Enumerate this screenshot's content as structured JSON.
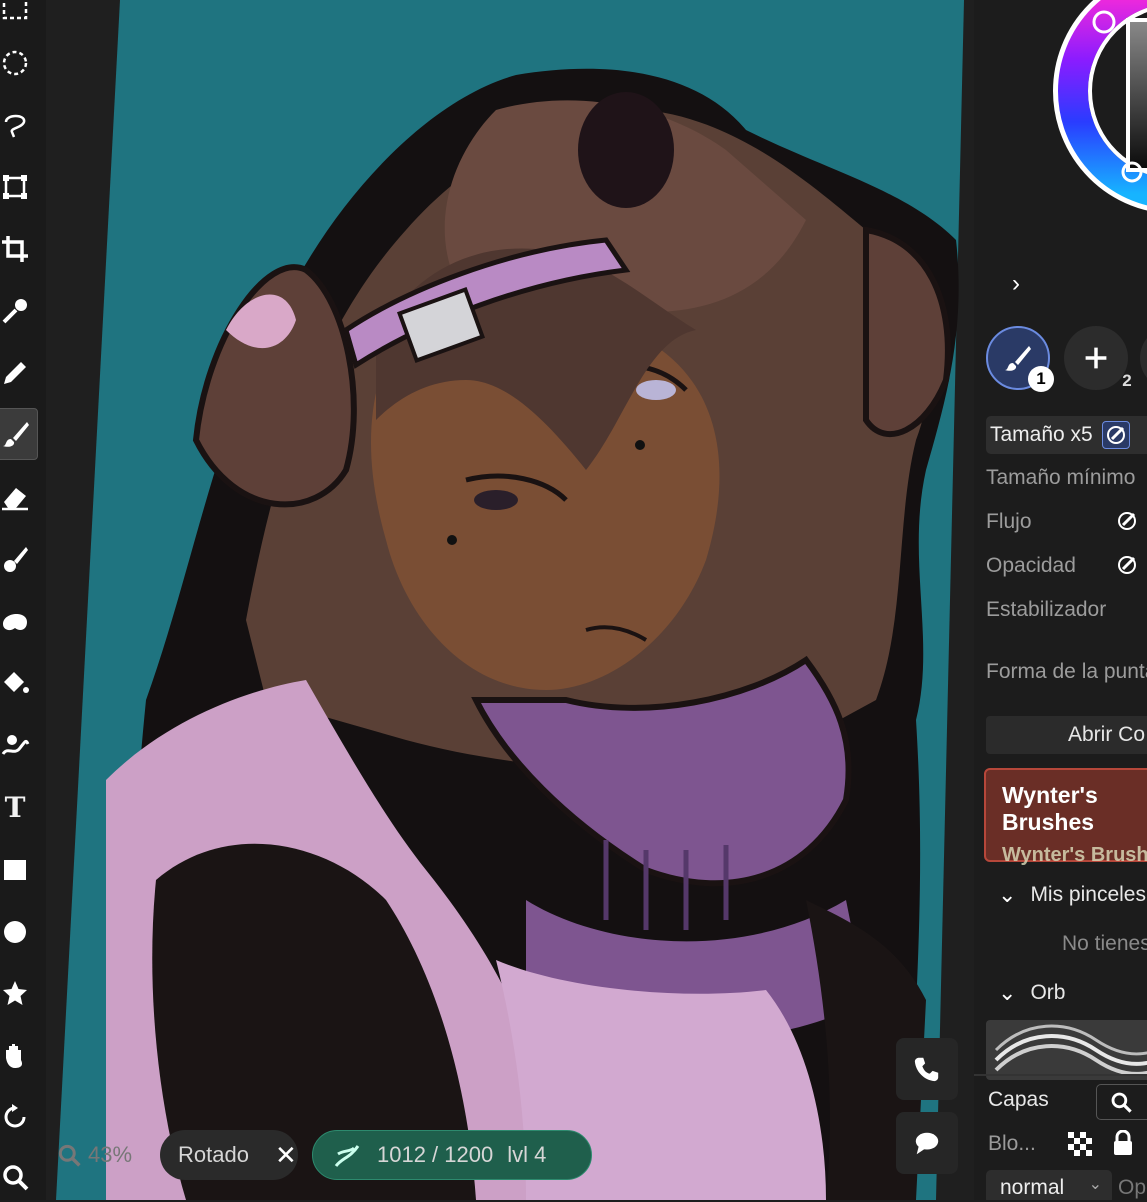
{
  "toolbar": {
    "tools": [
      "marquee-rect-icon",
      "marquee-ellipse-icon",
      "lasso-icon",
      "transform-icon",
      "crop-icon",
      "eyedropper-icon",
      "pencil-icon",
      "brush-icon",
      "eraser-icon",
      "smudge-icon",
      "blur-icon",
      "fill-icon",
      "liquify-icon",
      "text-icon",
      "rectangle-shape-icon",
      "ellipse-shape-icon",
      "star-shape-icon",
      "hand-icon",
      "rotate-icon",
      "zoom-icon"
    ],
    "active_tool": "brush-icon"
  },
  "canvas": {
    "zoom_label": "43%",
    "rotated_label": "Rotado",
    "rotated_close": "✕",
    "resolution_label": "1012 / 1200",
    "level_label": "lvl 4"
  },
  "colors": {
    "canvas_bg": "#1f7480",
    "accent_blue": "#6b8be0",
    "brush_card": "#6a2e26"
  },
  "panel": {
    "chevron": "›",
    "brush_slots": [
      {
        "icon": "brush-icon",
        "badge": "1"
      },
      {
        "icon": "plus-icon",
        "badge": "2"
      }
    ],
    "size_label": "Tamaño x5",
    "min_size_label": "Tamaño mínimo",
    "flow_label": "Flujo",
    "opacity_label": "Opacidad",
    "stabilizer_label": "Estabilizador",
    "tip_shape_label": "Forma de la punta",
    "open_button": "Abrir Co",
    "brush_card_title": "Wynter's Brushes",
    "brush_card_subtitle": "Wynter's Brushes",
    "my_brushes_label": "Mis pinceles",
    "empty_note": "No tienes",
    "orb_label": "Orb"
  },
  "layers": {
    "title": "Capas",
    "blend_label": "Blo...",
    "blend_mode": "normal",
    "opacity_short": "Op"
  }
}
